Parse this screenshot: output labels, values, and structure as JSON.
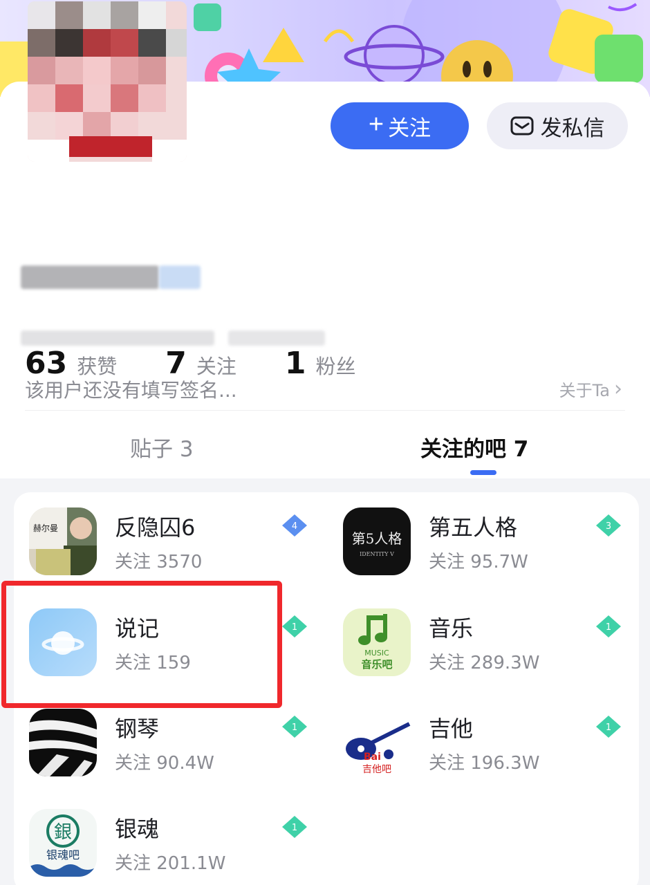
{
  "actions": {
    "follow_label": "关注",
    "message_label": "发私信"
  },
  "profile": {
    "signature": "该用户还没有填写签名...",
    "about_label": "关于Ta"
  },
  "stats": [
    {
      "value": "63",
      "label": "获赞"
    },
    {
      "value": "7",
      "label": "关注"
    },
    {
      "value": "1",
      "label": "粉丝"
    }
  ],
  "tabs": {
    "posts": "贴子 3",
    "followed_bars": "关注的吧 7"
  },
  "bars": [
    {
      "name": "反隐囚6",
      "followers": "关注 3570",
      "level": "4",
      "level_color": "#5b8ff0"
    },
    {
      "name": "第五人格",
      "followers": "关注 95.7W",
      "level": "3",
      "level_color": "#3fd1a8"
    },
    {
      "name": "说记",
      "followers": "关注 159",
      "level": "1",
      "level_color": "#3fd1a8"
    },
    {
      "name": "音乐",
      "followers": "关注 289.3W",
      "level": "1",
      "level_color": "#3fd1a8"
    },
    {
      "name": "钢琴",
      "followers": "关注 90.4W",
      "level": "1",
      "level_color": "#3fd1a8"
    },
    {
      "name": "吉他",
      "followers": "关注 196.3W",
      "level": "1",
      "level_color": "#3fd1a8"
    },
    {
      "name": "银魂",
      "followers": "关注 201.1W",
      "level": "1",
      "level_color": "#3fd1a8"
    }
  ],
  "icon_labels": {
    "hermann": "赫尔曼",
    "identity_main": "第5人格",
    "identity_sub": "IDENTITY V",
    "music_en": "MUSIC",
    "music_cn": "音乐吧",
    "guitar_brand": "Bai",
    "guitar_cn": "吉他吧",
    "gintama_seal": "銀",
    "gintama_text": "银魂吧"
  },
  "colors": {
    "accent": "#3b6cf3",
    "highlight": "#f0282c"
  }
}
